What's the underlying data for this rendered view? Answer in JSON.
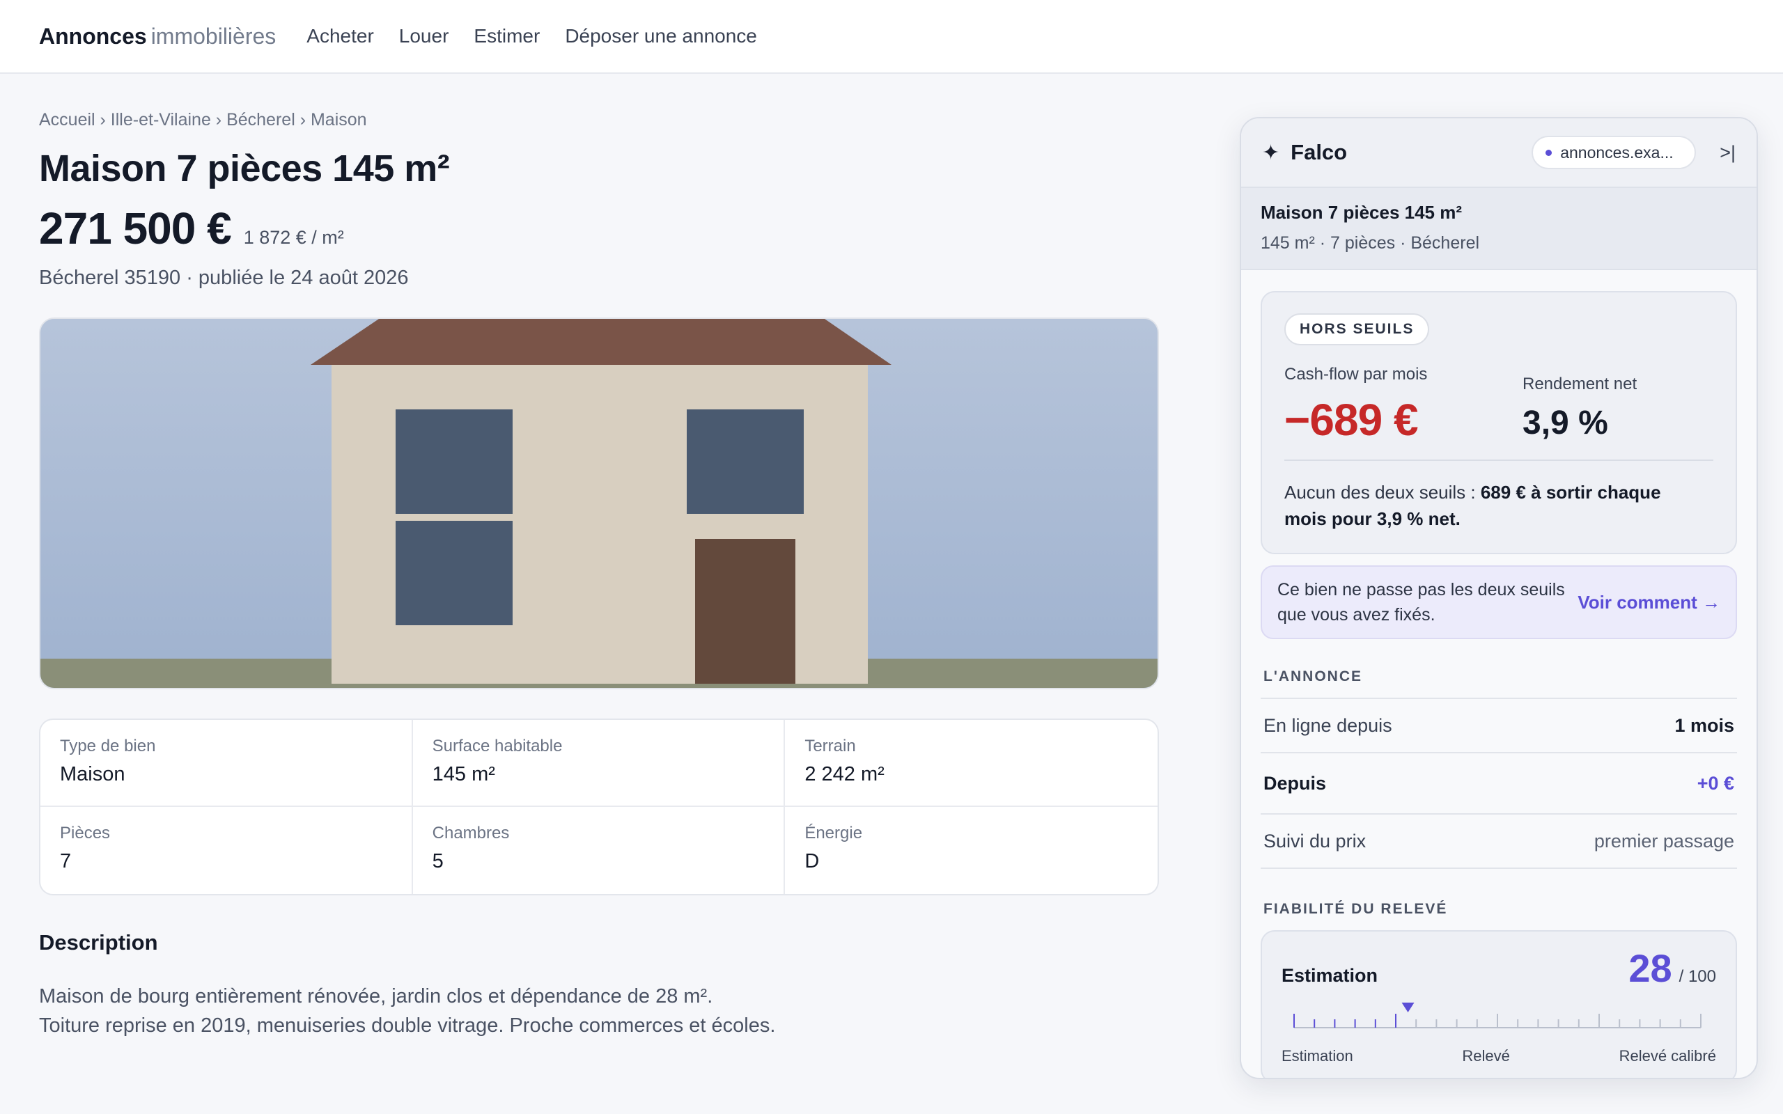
{
  "header": {
    "brand_strong": "Annonces",
    "brand_light": "immobilières",
    "nav": [
      "Acheter",
      "Louer",
      "Estimer",
      "Déposer une annonce"
    ]
  },
  "listing": {
    "breadcrumb": "Accueil › Ille-et-Vilaine › Bécherel › Maison",
    "title": "Maison 7 pièces 145 m²",
    "price": "271 500 €",
    "price_per_sqm": "1 872 € / m²",
    "location": "Bécherel 35190 · publiée le 24 août 2026",
    "specs": [
      {
        "label": "Type de bien",
        "value": "Maison"
      },
      {
        "label": "Surface habitable",
        "value": "145 m²"
      },
      {
        "label": "Terrain",
        "value": "2 242 m²"
      },
      {
        "label": "Pièces",
        "value": "7"
      },
      {
        "label": "Chambres",
        "value": "5"
      },
      {
        "label": "Énergie",
        "value": "D"
      }
    ],
    "description_title": "Description",
    "description_lines": [
      "Maison de bourg entièrement rénovée, jardin clos et dépendance de 28 m².",
      "Toiture reprise en 2019, menuiseries double vitrage. Proche commerces et écoles."
    ]
  },
  "panel": {
    "title": "Falco",
    "site": "annonces.exa...",
    "collapse_icon": ">|",
    "summary_title": "Maison 7 pièces 145 m²",
    "summary_sub": "145 m² · 7 pièces · Bécherel",
    "badge": "HORS SEUILS",
    "cashflow_label": "Cash-flow par mois",
    "cashflow_value": "−689 €",
    "yield_label": "Rendement net",
    "yield_value": "3,9 %",
    "note_prefix": "Aucun des deux seuils : ",
    "note_bold": "689 € à sortir chaque mois pour 3,9 % net.",
    "alert_text": "Ce bien ne passe pas les deux seuils que vous avez fixés.",
    "alert_link": "Voir comment →",
    "annonce_title": "L'ANNONCE",
    "rows": [
      {
        "label": "En ligne depuis",
        "value": "1 mois"
      },
      {
        "label": "Depuis",
        "value": "+0 €"
      },
      {
        "label": "Suivi du prix",
        "value": "premier passage"
      }
    ],
    "reliability_title": "FIABILITÉ DU RELEVÉ",
    "gauge": {
      "label": "Estimation",
      "score": "28",
      "max": "/ 100",
      "score_value": 28,
      "scale_labels": [
        "Estimation",
        "Relevé",
        "Relevé calibré"
      ]
    },
    "colors": {
      "accent": "#5b4ed6",
      "negative": "#c62828"
    }
  }
}
